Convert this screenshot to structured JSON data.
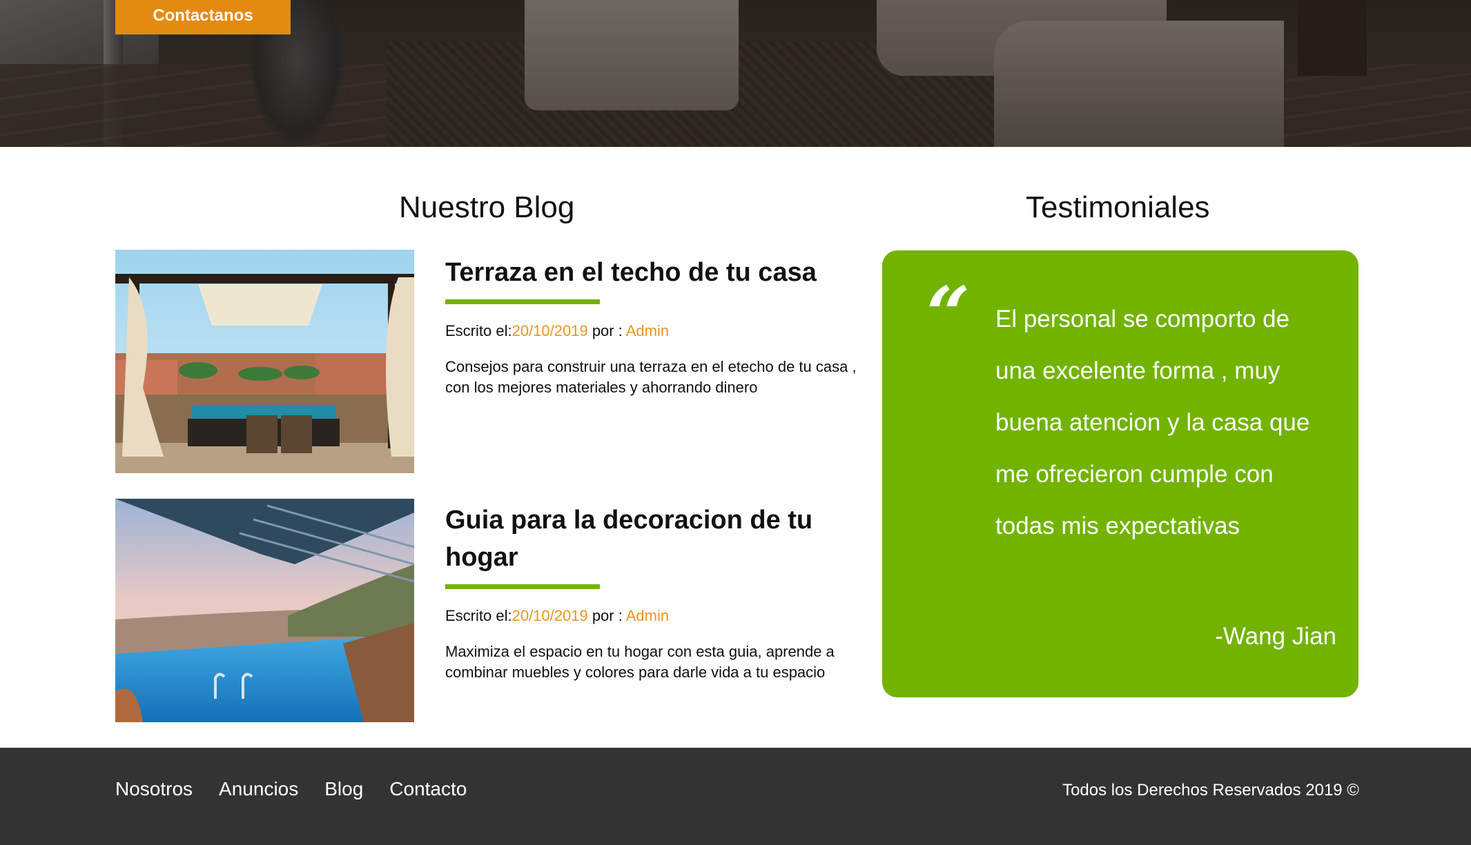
{
  "hero": {
    "contact_label": "Contactanos"
  },
  "blog": {
    "title": "Nuestro Blog",
    "posts": [
      {
        "title": "Terraza en el techo de tu casa",
        "meta_prefix": "Escrito el:",
        "date": "20/10/2019",
        "by": " por : ",
        "author": "Admin",
        "excerpt": "Consejos para construir una terraza en el etecho de tu casa , con los mejores materiales y ahorrando dinero"
      },
      {
        "title": "Guia para la decoracion de tu hogar",
        "meta_prefix": "Escrito el:",
        "date": "20/10/2019",
        "by": " por : ",
        "author": "Admin",
        "excerpt": "Maximiza el espacio en tu hogar con esta guia, aprende a combinar muebles y colores para darle vida a tu espacio"
      }
    ]
  },
  "testimonials": {
    "title": "Testimoniales",
    "quote_mark": "“",
    "text": "El personal se comporto de una excelente forma , muy buena atencion y la casa que me ofrecieron cumple con todas mis expectativas",
    "author": "-Wang Jian"
  },
  "footer": {
    "links": [
      "Nosotros",
      "Anuncios",
      "Blog",
      "Contacto"
    ],
    "copyright": "Todos los Derechos Reservados 2019 ©"
  },
  "colors": {
    "accent_orange": "#e38a10",
    "accent_green": "#72b300",
    "footer_bg": "#333333"
  }
}
